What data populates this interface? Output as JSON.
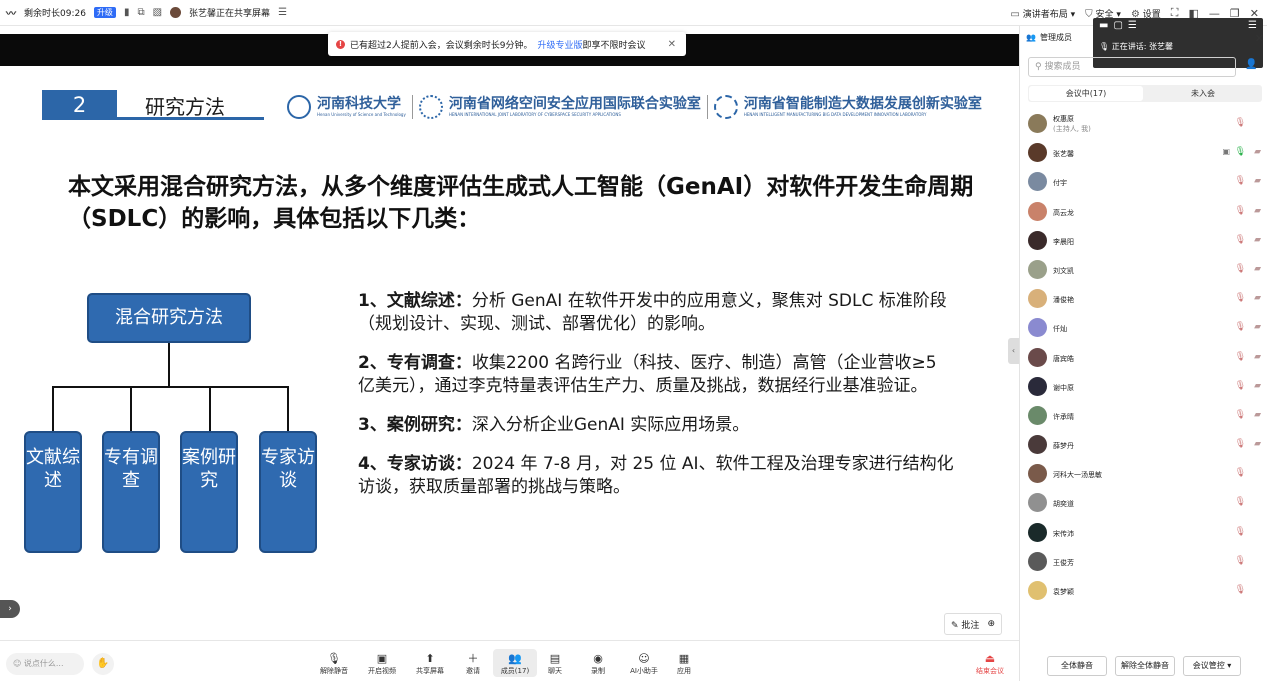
{
  "topbar": {
    "remaining_time": "剩余时长09:26",
    "upgrade": "升级",
    "sharing_status": "张艺馨正在共享屏幕",
    "layout": "演讲者布局",
    "security": "安全",
    "settings": "设置"
  },
  "notice": {
    "text": "已有超过2人提前入会，会议剩余时长9分钟。",
    "link": "升级专业版",
    "tail": "即享不限时会议"
  },
  "slide": {
    "section_number": "2",
    "section_title": "研究方法",
    "logos": [
      {
        "name": "河南科技大学",
        "sub": "Henan University of Science and Technology"
      },
      {
        "name": "河南省网络空间安全应用国际联合实验室",
        "sub": "HENAN INTERNATIONAL JOINT LABORATORY OF CYBERSPACE SECURITY APPLICATIONS"
      },
      {
        "name": "河南省智能制造大数据发展创新实验室",
        "sub": "HENAN INTELLIGENT MANUFACTURING BIG DATA DEVELOPMENT INNOVATION LABORATORY"
      }
    ],
    "headline": "本文采用混合研究方法，从多个维度评估生成式人工智能（GenAI）对软件开发生命周期（SDLC）的影响，具体包括以下几类：",
    "diagram": {
      "root": "混合研究方法",
      "leaves": [
        "文献综述",
        "专有调查",
        "案例研究",
        "专家访谈"
      ]
    },
    "items": [
      {
        "label": "1、文献综述：",
        "text": "分析 GenAI 在软件开发中的应用意义，聚焦对 SDLC 标准阶段（规划设计、实现、测试、部署优化）的影响。"
      },
      {
        "label": "2、专有调查：",
        "text": "收集2200 名跨行业（科技、医疗、制造）高管（企业营收≥5 亿美元），通过李克特量表评估生产力、质量及挑战，数据经行业基准验证。"
      },
      {
        "label": "3、案例研究：",
        "text": "深入分析企业GenAI 实际应用场景。"
      },
      {
        "label": "4、专家访谈：",
        "text": "2024 年 7-8 月，对 25 位 AI、软件工程及治理专家进行结构化访谈，获取质量部署的挑战与策略。"
      }
    ],
    "annotate": "批注"
  },
  "bottombar": {
    "chat_placeholder": "说点什么...",
    "tools": [
      {
        "label": "解除静音",
        "icon": "mic-off-icon",
        "glyph": "🎙"
      },
      {
        "label": "开启视频",
        "icon": "video-off-icon",
        "glyph": "▣"
      },
      {
        "label": "共享屏幕",
        "icon": "share-screen-icon",
        "glyph": "⬆"
      },
      {
        "label": "邀请",
        "icon": "invite-icon",
        "glyph": "＋"
      },
      {
        "label": "成员(17)",
        "icon": "members-icon",
        "glyph": "👥"
      },
      {
        "label": "聊天",
        "icon": "chat-icon",
        "glyph": "▤"
      },
      {
        "label": "录制",
        "icon": "record-icon",
        "glyph": "◉"
      },
      {
        "label": "AI小助手",
        "icon": "ai-assistant-icon",
        "glyph": "☺"
      },
      {
        "label": "应用",
        "icon": "apps-icon",
        "glyph": "▦"
      }
    ],
    "end_meeting": "结束会议"
  },
  "panel": {
    "title": "管理成员",
    "speaking_label": "正在讲话:",
    "speaking_name": "张艺馨",
    "search_placeholder": "搜索成员",
    "tab_in_meeting": "会议中(17)",
    "tab_not_joined": "未入会",
    "members": [
      {
        "name": "权惠原",
        "sub": "(主持人, 我)",
        "color": "#8a7a5a"
      },
      {
        "name": "张艺馨",
        "sub": "",
        "color": "#5a3a2a",
        "speaking": true
      },
      {
        "name": "付宇",
        "sub": "",
        "color": "#7a8aa0"
      },
      {
        "name": "高云龙",
        "sub": "",
        "color": "#c9826a"
      },
      {
        "name": "李晨阳",
        "sub": "",
        "color": "#3a2a2a"
      },
      {
        "name": "刘文凯",
        "sub": "",
        "color": "#9aa08a"
      },
      {
        "name": "潘俊艳",
        "sub": "",
        "color": "#d8b07a"
      },
      {
        "name": "仟灿",
        "sub": "",
        "color": "#8a8ad0"
      },
      {
        "name": "唐宾皓",
        "sub": "",
        "color": "#6a4a4a"
      },
      {
        "name": "谢中原",
        "sub": "",
        "color": "#2a2a3a"
      },
      {
        "name": "许承晴",
        "sub": "",
        "color": "#6a8a6a"
      },
      {
        "name": "薛梦丹",
        "sub": "",
        "color": "#4a3a3a"
      },
      {
        "name": "河科大一汤思敏",
        "sub": "",
        "color": "#7a5a4a"
      },
      {
        "name": "胡奕道",
        "sub": "",
        "color": "#909090"
      },
      {
        "name": "宋传沛",
        "sub": "",
        "color": "#1a2a2a"
      },
      {
        "name": "王俊芳",
        "sub": "",
        "color": "#5a5a5a"
      },
      {
        "name": "袁梦颖",
        "sub": "",
        "color": "#e0c070"
      }
    ],
    "footer": {
      "mute_all": "全体静音",
      "unmute_all": "解除全体静音",
      "controls": "会议管控"
    }
  }
}
